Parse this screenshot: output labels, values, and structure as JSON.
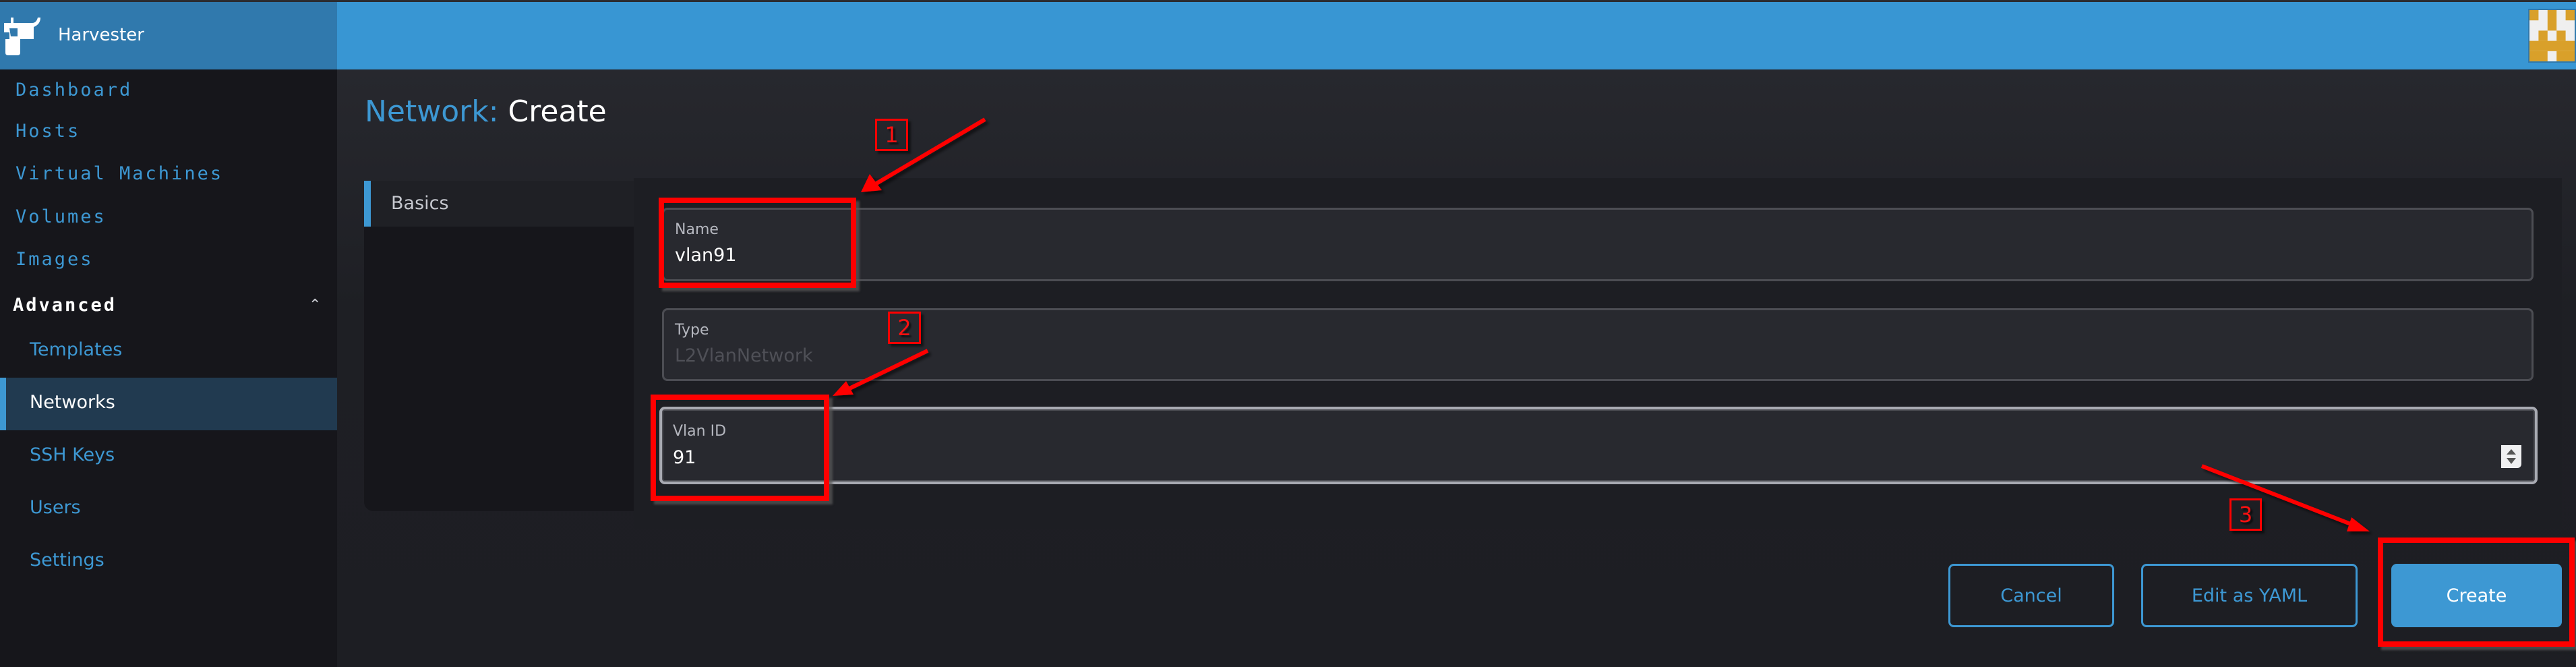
{
  "app": {
    "brand": "Harvester"
  },
  "sidebar": {
    "top_items": [
      {
        "label": "Dashboard"
      },
      {
        "label": "Hosts"
      },
      {
        "label": "Virtual Machines"
      },
      {
        "label": "Volumes"
      },
      {
        "label": "Images"
      }
    ],
    "group": {
      "label": "Advanced",
      "expanded": true,
      "items": [
        {
          "label": "Templates",
          "active": false
        },
        {
          "label": "Networks",
          "active": true
        },
        {
          "label": "SSH Keys",
          "active": false
        },
        {
          "label": "Users",
          "active": false
        },
        {
          "label": "Settings",
          "active": false
        }
      ]
    }
  },
  "page": {
    "title_resource": "Network:",
    "title_action": "Create"
  },
  "tabs": [
    {
      "label": "Basics",
      "active": true
    }
  ],
  "form": {
    "name": {
      "label": "Name",
      "value": "vlan91"
    },
    "type": {
      "label": "Type",
      "value": "L2VlanNetwork",
      "disabled": true
    },
    "vlan_id": {
      "label": "Vlan ID",
      "value": "91",
      "focused": true
    }
  },
  "buttons": {
    "cancel": "Cancel",
    "edit_yaml": "Edit as YAML",
    "create": "Create"
  },
  "annotations": {
    "step1": "1",
    "step2": "2",
    "step3": "3",
    "color": "#ff0000"
  },
  "colors": {
    "accent": "#3d98d3",
    "header": "#3896d3",
    "brand_bg": "#3079ad",
    "sidebar_bg": "#16161b",
    "active_nav_bg": "#213a50"
  }
}
